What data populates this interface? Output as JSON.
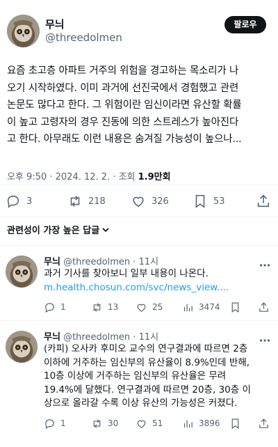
{
  "main_tweet": {
    "author_name": "무늬",
    "author_handle": "@threedolmen",
    "follow_label": "팔로우",
    "text_lines": [
      "요즘 초고층 아파트 거주의 위험을 경고하는 목소리가 나",
      "오기 시작하였다. 이미 과거에 선진국에서 경험했고 관련",
      "논문도 많다고 한다. 그 위험이란 임신이라면 유산할 확률",
      "이 높고 고령자의 경우 진동에 의한 스트레스가 높아진다",
      "고 한다. 아무래도 이런 내용은 숨겨질 가능성이 높으나..."
    ],
    "timestamp": "오후 9:50 · 2024. 12. 2. · 조회 ",
    "views": "1.9만회",
    "stats": {
      "replies": "3",
      "retweets": "218",
      "likes": "326",
      "bookmarks": "53"
    }
  },
  "sort_label": "관련성이 가장 높은 답글",
  "replies": [
    {
      "author_name": "무늬",
      "handle_time": "@threedolmen · 11시",
      "text_lines": [
        "과거 기사를 찾아보니 일부 내용이 나온다."
      ],
      "link": "m.health.chosun.com/svc/news_view....",
      "stats": {
        "replies": "1",
        "retweets": "13",
        "likes": "25",
        "views": "3474"
      }
    },
    {
      "author_name": "무늬",
      "handle_time": "@threedolmen · 11시",
      "text_lines": [
        "(카피) 오사카 후미오 교수의 연구결과에 따르면 2층",
        "이하에 거주하는 임신부의 유산율이 8.9%인데 반해,",
        "10층 이상에 거주하는 임신부의 유산율은 무려",
        "19.4%에 달했다. 연구결과에 따르면 20층, 30층 이",
        "상으로 올라갈 수록 이상 유산의 가능성은 커졌다."
      ],
      "stats": {
        "replies": "1",
        "retweets": "30",
        "likes": "51",
        "views": "3896"
      }
    }
  ],
  "icons": {
    "reply": "reply-icon",
    "retweet": "retweet-icon",
    "like": "heart-icon",
    "bookmark": "bookmark-icon",
    "share": "share-icon",
    "views": "views-icon",
    "more": "more-icon"
  },
  "colors": {
    "text": "#0f1419",
    "secondary": "#536471",
    "link": "#1d9bf0",
    "follow_bg": "#0f1419"
  }
}
